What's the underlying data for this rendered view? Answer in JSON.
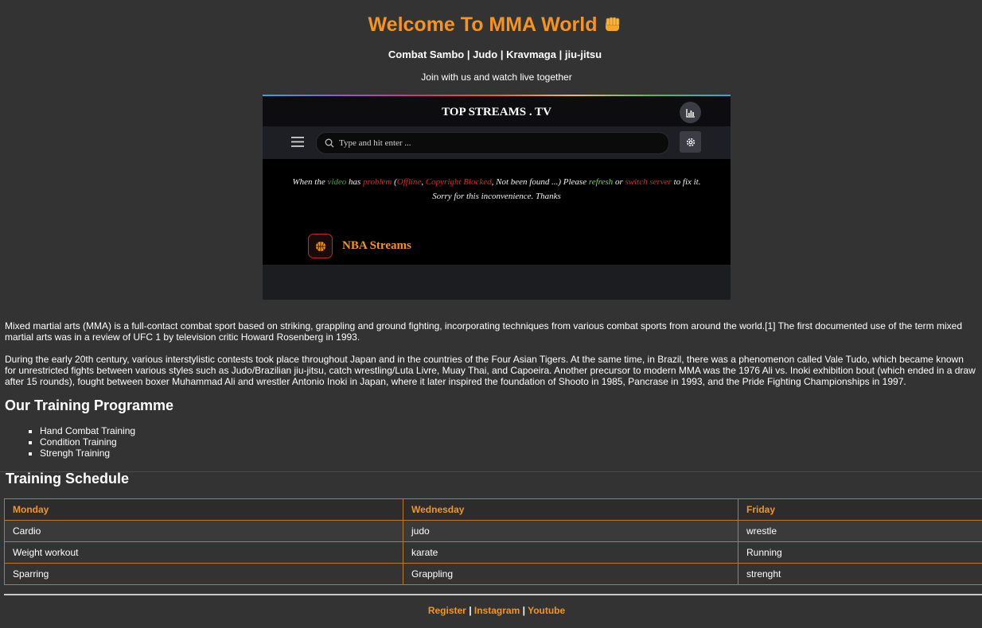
{
  "header": {
    "title": "Welcome To MMA World",
    "sports": [
      "Combat Sambo",
      "Judo",
      "Kravmaga",
      "jiu-jitsu"
    ],
    "separator": "|",
    "tagline": "Join with us and watch live together"
  },
  "widget": {
    "title": "TOP STREAMS . TV",
    "search_placeholder": "Type and hit enter ...",
    "notice": {
      "t1": "When the ",
      "video": "video",
      "t2": " has ",
      "problem": "problem",
      "t3": " (",
      "offline": "Offline",
      "t4": ", ",
      "copyright": "Copyright Blocked",
      "t5": ", Not been found ...) Please ",
      "refresh": "refresh",
      "t6": " or ",
      "switch": "switch server",
      "t7": " to fix it. Sorry for this inconvenience. Thanks"
    },
    "nba_label": "NBA Streams",
    "colors": {
      "accent": "#f7941d",
      "green": "#3aa63a",
      "red": "#e0232a",
      "lime": "#7fd13a"
    }
  },
  "content": {
    "para1": "Mixed martial arts (MMA) is a full-contact combat sport based on striking, grappling and ground fighting, incorporating techniques from various combat sports from around the world.[1] The first documented use of the term mixed martial arts was in a review of UFC 1 by television critic Howard Rosenberg in 1993.",
    "para2": "During the early 20th century, various interstylistic contests took place throughout Japan and in the countries of the Four Asian Tigers. At the same time, in Brazil, there was a phenomenon called Vale Tudo, which became known for unrestricted fights between various styles such as Judo/Brazilian jiu-jitsu, catch wrestling/Luta Livre, Muay Thai, and Capoeira. Another precursor to modern MMA was the 1976 Ali vs. Inoki exhibition bout (which ended in a draw after 15 rounds), fought between boxer Muhammad Ali and wrestler Antonio Inoki in Japan, where it later inspired the foundation of Shooto in 1985, Pancrase in 1993, and the Pride Fighting Championships in 1997.",
    "training_heading": "Our Training Programme",
    "training_items": [
      "Hand Combat Training",
      "Condition Training",
      "Strengh Training"
    ]
  },
  "schedule": {
    "heading": "Training Schedule",
    "columns": [
      "Monday",
      "Wednesday",
      "Friday"
    ],
    "rows": [
      [
        "Cardio",
        "judo",
        "wrestle"
      ],
      [
        "Weight workout",
        "karate",
        "Running"
      ],
      [
        "Sparring",
        "Grappling",
        "strenght"
      ]
    ]
  },
  "footer": {
    "links": [
      "Register",
      "Instagram",
      "Youtube"
    ],
    "separator": "|"
  }
}
